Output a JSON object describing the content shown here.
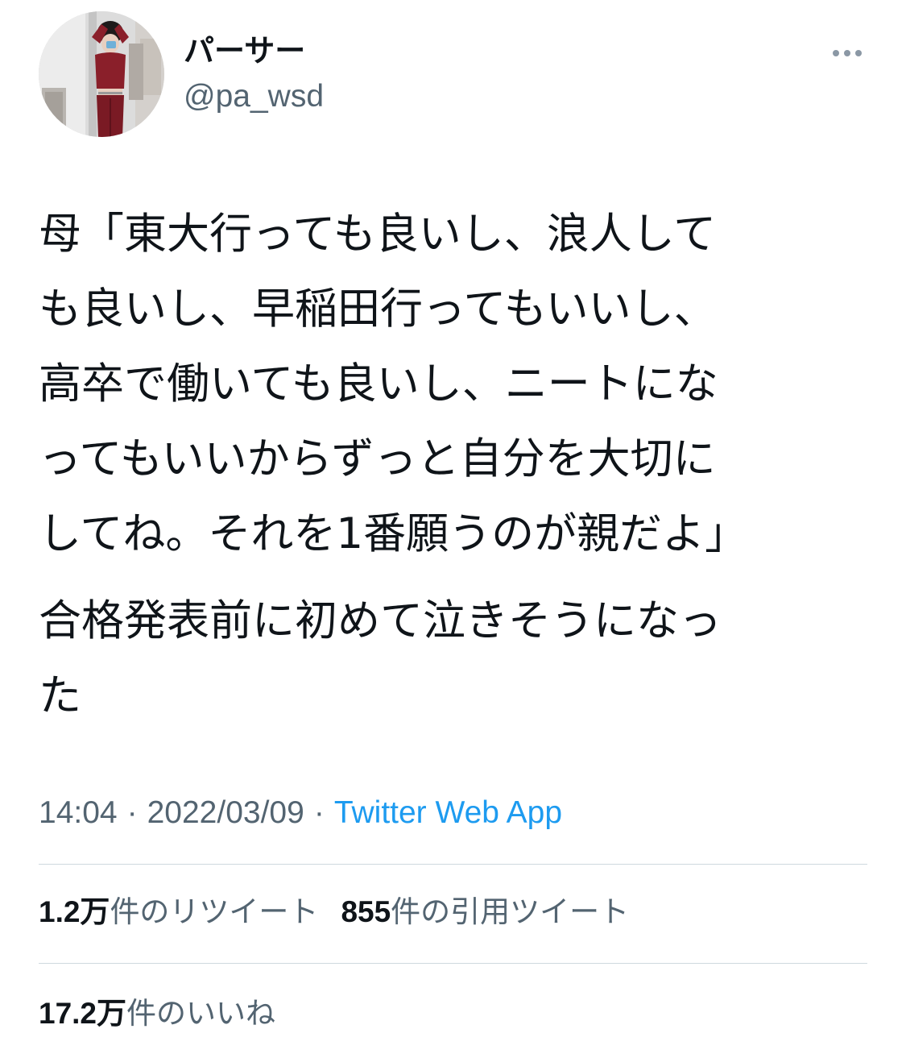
{
  "author": {
    "display_name": "パーサー",
    "handle": "@pa_wsd"
  },
  "more_icon": "more-horizontal-icon",
  "tweet": {
    "paragraphs": [
      "母「東大行っても良いし、浪人して\nも良いし、早稲田行ってもいいし、\n高卒で働いても良いし、ニートにな\nってもいいからずっと自分を大切に\nしてね。それを1番願うのが親だよ」",
      "合格発表前に初めて泣きそうになっ\nた"
    ]
  },
  "meta": {
    "time": "14:04",
    "separator": "·",
    "date": "2022/03/09",
    "app": "Twitter Web App"
  },
  "stats": {
    "retweets": {
      "count": "1.2万",
      "label": "件のリツイート"
    },
    "quotes": {
      "count": "855",
      "label": "件の引用ツイート"
    },
    "likes": {
      "count": "17.2万",
      "label": "件のいいね"
    }
  },
  "colors": {
    "text": "#0f1419",
    "secondary": "#536471",
    "link": "#1d9bf0",
    "divider": "#cfd9de"
  }
}
